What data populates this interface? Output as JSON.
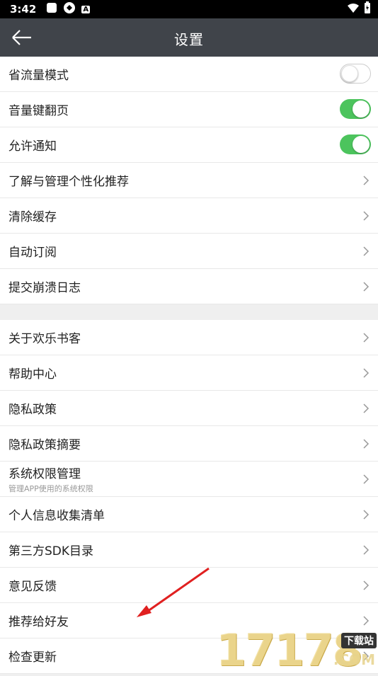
{
  "status_bar": {
    "time": "3:42",
    "badge_text": "A"
  },
  "toolbar": {
    "title": "设置",
    "back_icon": "arrow-left-icon"
  },
  "settings": {
    "group1": [
      {
        "label": "省流量模式",
        "type": "toggle",
        "on": false
      },
      {
        "label": "音量键翻页",
        "type": "toggle",
        "on": true
      },
      {
        "label": "允许通知",
        "type": "toggle",
        "on": true
      },
      {
        "label": "了解与管理个性化推荐",
        "type": "link"
      },
      {
        "label": "清除缓存",
        "type": "link"
      },
      {
        "label": "自动订阅",
        "type": "link"
      },
      {
        "label": "提交崩溃日志",
        "type": "link"
      }
    ],
    "group2": [
      {
        "label": "关于欢乐书客",
        "type": "link"
      },
      {
        "label": "帮助中心",
        "type": "link"
      },
      {
        "label": "隐私政策",
        "type": "link"
      },
      {
        "label": "隐私政策摘要",
        "type": "link"
      },
      {
        "label": "系统权限管理",
        "sub": "管理APP使用的系统权限",
        "type": "link"
      },
      {
        "label": "个人信息收集清单",
        "type": "link"
      },
      {
        "label": "第三方SDK目录",
        "type": "link"
      },
      {
        "label": "意见反馈",
        "type": "link"
      },
      {
        "label": "推荐给好友",
        "type": "link"
      },
      {
        "label": "检查更新",
        "type": "link"
      }
    ]
  },
  "colors": {
    "toolbar": "#40444a",
    "toggle_on": "#4cc45d",
    "arrow": "#e02020"
  },
  "watermark": {
    "number": "17178",
    "tag": "下载站",
    "suffix": ".COM"
  }
}
